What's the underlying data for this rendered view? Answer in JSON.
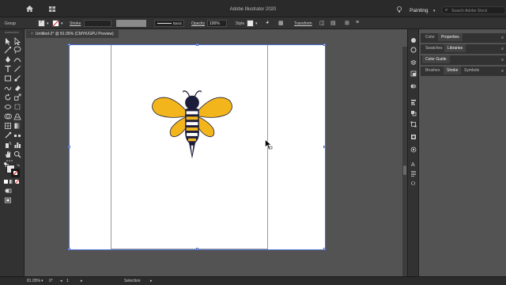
{
  "titlebar": {
    "title": "Adobe Illustrator 2020",
    "workspace": "Painting",
    "search_placeholder": "Search Adobe Stock"
  },
  "control_bar": {
    "selection_label": "Group",
    "stroke_label": "Stroke",
    "brush_label": "Basic",
    "opacity_label": "Opacity",
    "opacity_value": "100%",
    "style_label": "Style",
    "transform_label": "Transform"
  },
  "document": {
    "tab_title": "Untitled-2* @ 81.05% (CMYK/GPU Preview)",
    "close_symbol": "×"
  },
  "status_bar": {
    "zoom": "81.05%",
    "rotate": "0°",
    "artboard": "1",
    "tool": "Selection"
  },
  "panels": {
    "group1": {
      "tabs": [
        "Color",
        "Properties"
      ],
      "active": "Properties"
    },
    "group2": {
      "tabs": [
        "Swatches",
        "Libraries"
      ],
      "active": "Libraries"
    },
    "group3": {
      "tabs": [
        "Color Guide"
      ],
      "active": "Color Guide"
    },
    "group4": {
      "tabs": [
        "Brushes",
        "Stroke",
        "Symbols"
      ],
      "active": "Stroke"
    }
  },
  "artwork": {
    "subject": "bee",
    "colors": {
      "wing": "#f2b51c",
      "body_dark": "#1c1d3a",
      "body_white": "#ffffff",
      "outline": "#1c1d3a"
    }
  },
  "colors": {
    "artboard_selection": "#4d6fd0",
    "ui_dark": "#323232",
    "pasteboard": "#535353"
  }
}
